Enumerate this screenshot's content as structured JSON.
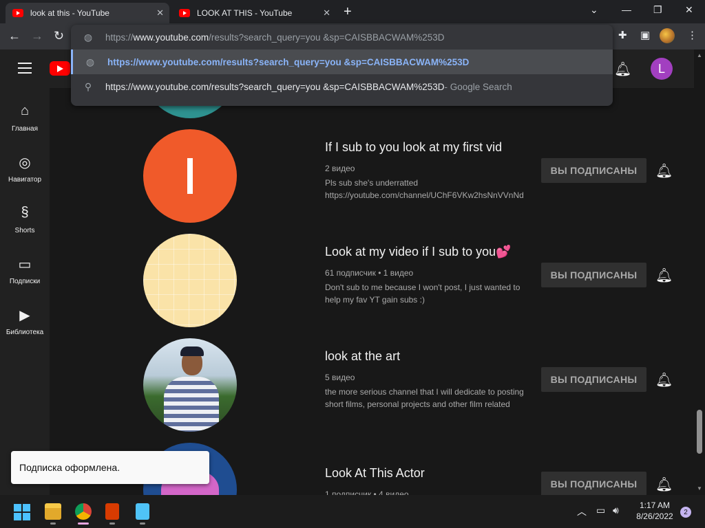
{
  "browser": {
    "tabs": [
      {
        "title": "look at this - YouTube",
        "active": true
      },
      {
        "title": "LOOK AT THIS - YouTube",
        "active": false
      }
    ],
    "omnibox": {
      "input_prefix": "https://",
      "input_host": "www.youtube.com",
      "input_rest": "/results?search_query=you &sp=CAISBBACWAM%253D",
      "selected_suggestion": "https://www.youtube.com/results?search_query=you &sp=CAISBBACWAM%253D",
      "search_suggestion": "https://www.youtube.com/results?search_query=you &sp=CAISBBACWAM%253D",
      "search_suggestion_suffix": " - Google Search"
    }
  },
  "youtube": {
    "user_initial": "L",
    "sidebar": [
      {
        "label": "Главная",
        "icon": "home-icon"
      },
      {
        "label": "Навигатор",
        "icon": "compass-icon"
      },
      {
        "label": "Shorts",
        "icon": "shorts-icon"
      },
      {
        "label": "Подписки",
        "icon": "subscriptions-icon"
      },
      {
        "label": "Библиотека",
        "icon": "library-icon"
      }
    ],
    "channels": [
      {
        "title": "If I sub to you look at my first vid",
        "meta": "2 видео",
        "desc_line1": "Pls sub she's underratted",
        "desc_line2": "https://youtube.com/channel/UChF6VKw2hsNnVVnNd",
        "button": "ВЫ ПОДПИСАНЫ"
      },
      {
        "title": "Look at my video if I sub to you💕",
        "meta": "61 подписчик • 1 видео",
        "desc_line1": "Don't sub to me because I won't post, I just wanted to",
        "desc_line2": "help my fav YT gain subs :)",
        "button": "ВЫ ПОДПИСАНЫ"
      },
      {
        "title": "look at the art",
        "meta": "5 видео",
        "desc_line1": "the more serious channel that I will dedicate to posting",
        "desc_line2": "short films, personal projects and other film related",
        "button": "ВЫ ПОДПИСАНЫ"
      },
      {
        "title": "Look At This Actor",
        "meta": "1 подписчик • 4 видео",
        "desc_line1": "",
        "desc_line2": "",
        "button": "ВЫ ПОДПИСАНЫ"
      }
    ],
    "toast": "Подписка оформлена."
  },
  "taskbar": {
    "time": "1:17 AM",
    "date": "8/26/2022",
    "notifications": "2"
  }
}
